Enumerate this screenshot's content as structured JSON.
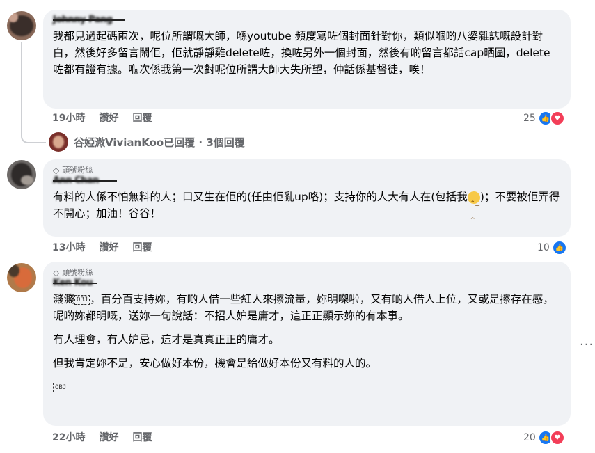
{
  "comments": [
    {
      "author": "Johnny Pang",
      "text": "我都見過起碼兩次，呢位所謂嘅大師，喺youtube 頻度寫咗個封面針對你，類似嗰啲八婆雜誌嘅設計對白，然後好多留言鬧佢，佢就靜靜雞delete咗，換咗另外一個封面，然後有啲留言都話cap晒圖，delete咗都有證有據。嗰次係我第一次對呢位所謂大師大失所望，仲話係基督徒，唉！",
      "time": "19小時",
      "like_label": "讚好",
      "reply_label": "回覆",
      "reaction_count": "25",
      "reactions": [
        "like-icon",
        "love-icon"
      ]
    },
    {
      "badge": "頭號粉絲",
      "author": "Ann Chan",
      "text_before": "有料的人係不怕無料的人；口又生在佢的(任由佢亂up咯)；支持你的人大有人在(包括我",
      "text_after": ")；不要被佢弄得不開心；加油！谷谷！",
      "time": "13小時",
      "like_label": "讚好",
      "reply_label": "回覆",
      "reaction_count": "10",
      "reactions": [
        "like-icon"
      ]
    },
    {
      "badge": "頭號粉絲",
      "author": "Ken Kou",
      "para1_start": "濺濺",
      "obj": "OBJ",
      "para1_rest": "，百分百支持妳，有啲人借一些紅人來擦流量，妳明㗎啦，又有啲人借人上位，又或是擦存在感，呢啲妳都明嘅，送妳一句說話：不招人妒是庸才，這正正顯示妳的有本事。",
      "para2": "冇人理會，冇人妒忌，這才是真真正正的庸才。",
      "para3": "但我肯定妳不是，安心做好本份，機會是給做好本份又有料的人的。",
      "time": "22小時",
      "like_label": "讚好",
      "reply_label": "回覆",
      "reaction_count": "20",
      "reactions": [
        "like-icon",
        "love-icon"
      ]
    }
  ],
  "replies_summary": "谷婭溦VivianKoo已回覆 · 3個回覆",
  "more_label": "···",
  "colors": {
    "bubble": "#f0f2f5",
    "meta": "#65676b",
    "like": "#1877f2",
    "love": "#f33e58"
  }
}
